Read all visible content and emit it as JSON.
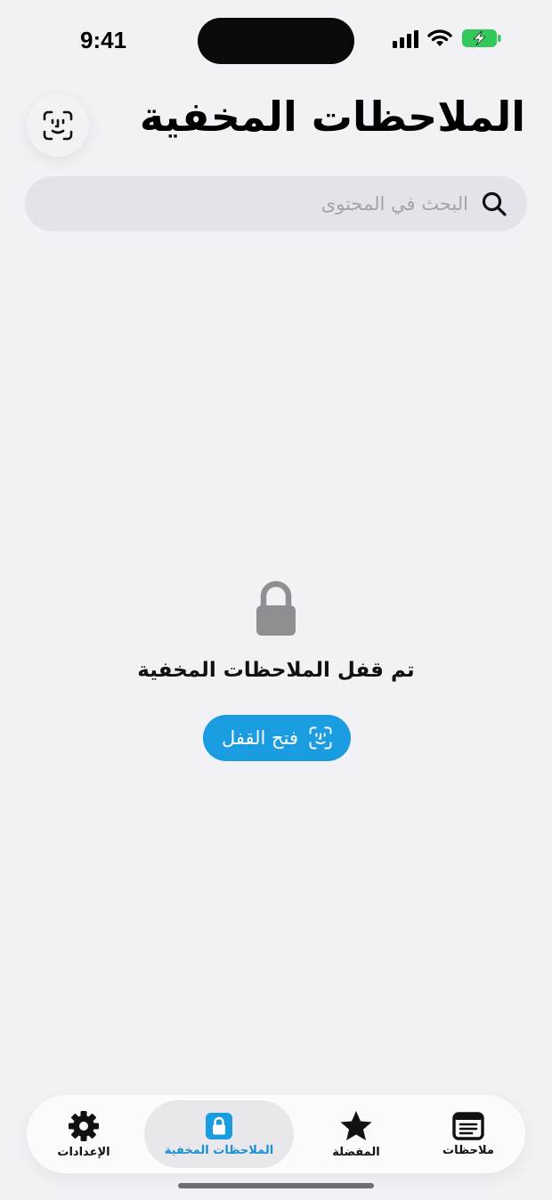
{
  "status_bar": {
    "time": "9:41"
  },
  "header": {
    "title": "الملاحظات المخفية"
  },
  "search": {
    "placeholder": "البحث في المحتوى"
  },
  "locked_state": {
    "message": "تم قفل الملاحظات المخفية",
    "unlock_label": "فتح القفل"
  },
  "tabbar": {
    "items": [
      {
        "label": "ملاحظات",
        "icon": "notes-icon"
      },
      {
        "label": "المفضلة",
        "icon": "star-icon"
      },
      {
        "label": "الملاحظات المخفية",
        "icon": "lock-icon",
        "active": true
      },
      {
        "label": "الإعدادات",
        "icon": "gear-icon"
      }
    ]
  },
  "colors": {
    "accent": "#1a9ce0",
    "active_tab_text": "#1a8fd2",
    "battery": "#34c759"
  }
}
